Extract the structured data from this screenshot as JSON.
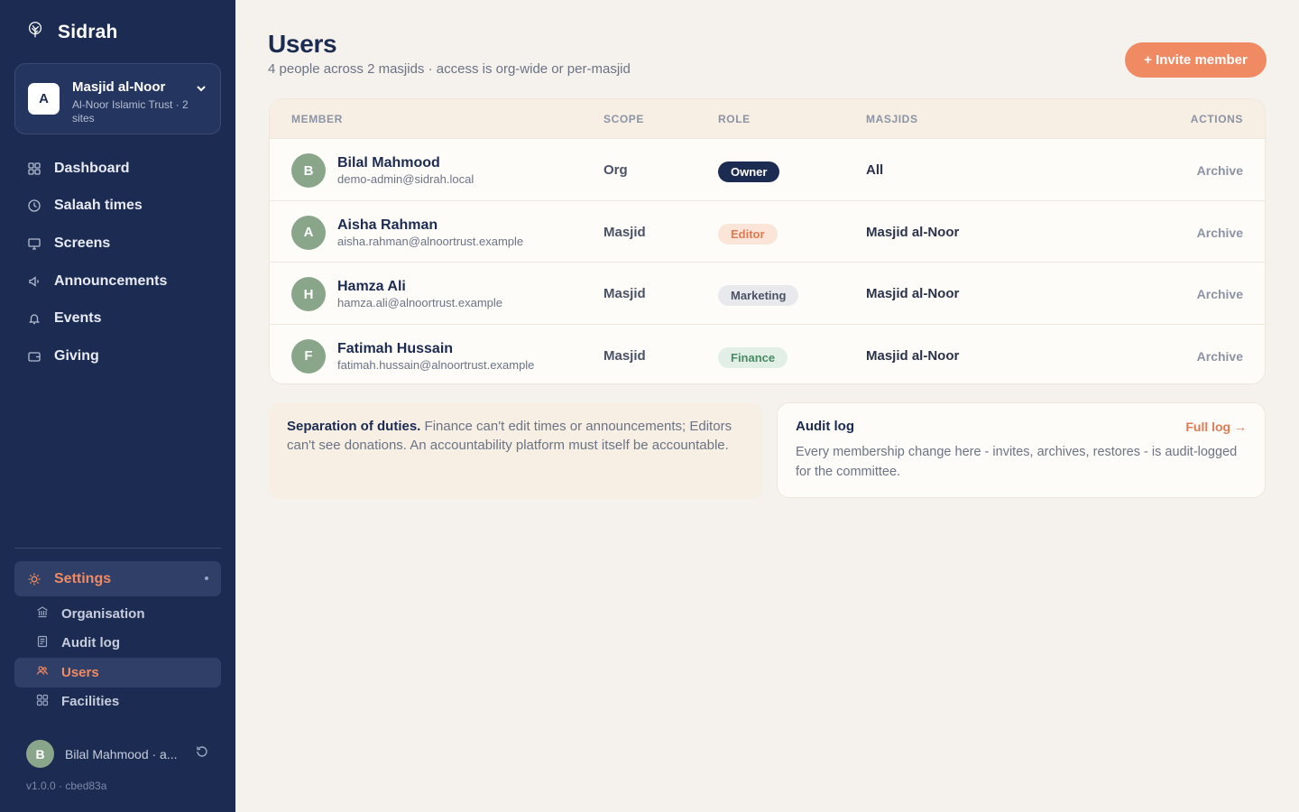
{
  "sidebar": {
    "brand": "Sidrah",
    "org": {
      "initial": "A",
      "name": "Masjid al-Noor",
      "sub": "Al-Noor Islamic Trust · 2 sites"
    },
    "nav": [
      {
        "label": "Dashboard",
        "icon": "grid-icon"
      },
      {
        "label": "Salaah times",
        "icon": "clock-icon"
      },
      {
        "label": "Screens",
        "icon": "monitor-icon"
      },
      {
        "label": "Announcements",
        "icon": "megaphone-icon"
      },
      {
        "label": "Events",
        "icon": "bell-icon"
      },
      {
        "label": "Giving",
        "icon": "wallet-icon"
      }
    ],
    "settings": {
      "label": "Settings",
      "icon": "sun-icon"
    },
    "subnav": [
      {
        "label": "Organisation",
        "icon": "building-icon"
      },
      {
        "label": "Audit log",
        "icon": "document-icon"
      },
      {
        "label": "Users",
        "icon": "users-icon",
        "active": true
      },
      {
        "label": "Facilities",
        "icon": "grid-icon"
      }
    ],
    "user": {
      "initial": "B",
      "name": "Bilal Mahmood · a..."
    },
    "version": "v1.0.0 · cbed83a"
  },
  "header": {
    "title": "Users",
    "subtitle": "4 people across 2 masjids · access is org-wide or per-masjid",
    "invite_label": "+ Invite member"
  },
  "table": {
    "columns": {
      "member": "MEMBER",
      "scope": "SCOPE",
      "role": "ROLE",
      "masjids": "MASJIDS",
      "actions": "ACTIONS"
    },
    "rows": [
      {
        "initial": "B",
        "name": "Bilal Mahmood",
        "email": "demo-admin@sidrah.local",
        "scope": "Org",
        "role": "Owner",
        "masjids": "All",
        "action": "Archive"
      },
      {
        "initial": "A",
        "name": "Aisha Rahman",
        "email": "aisha.rahman@alnoortrust.example",
        "scope": "Masjid",
        "role": "Editor",
        "masjids": "Masjid al-Noor",
        "action": "Archive"
      },
      {
        "initial": "H",
        "name": "Hamza Ali",
        "email": "hamza.ali@alnoortrust.example",
        "scope": "Masjid",
        "role": "Marketing",
        "masjids": "Masjid al-Noor",
        "action": "Archive"
      },
      {
        "initial": "F",
        "name": "Fatimah Hussain",
        "email": "fatimah.hussain@alnoortrust.example",
        "scope": "Masjid",
        "role": "Finance",
        "masjids": "Masjid al-Noor",
        "action": "Archive"
      }
    ]
  },
  "duties": {
    "lead": "Separation of duties.",
    "text": " Finance can't edit times or announcements; Editors can't see donations. An accountability platform must itself be accountable."
  },
  "audit": {
    "title": "Audit log",
    "link": "Full log →",
    "text": "Every membership change here - invites, archives, restores - is audit-logged for the committee."
  },
  "colors": {
    "sidebar_bg": "#1c2b52",
    "accent": "#f08a62",
    "page_bg": "#f5f1ec",
    "avatar": "#8aa68a"
  }
}
